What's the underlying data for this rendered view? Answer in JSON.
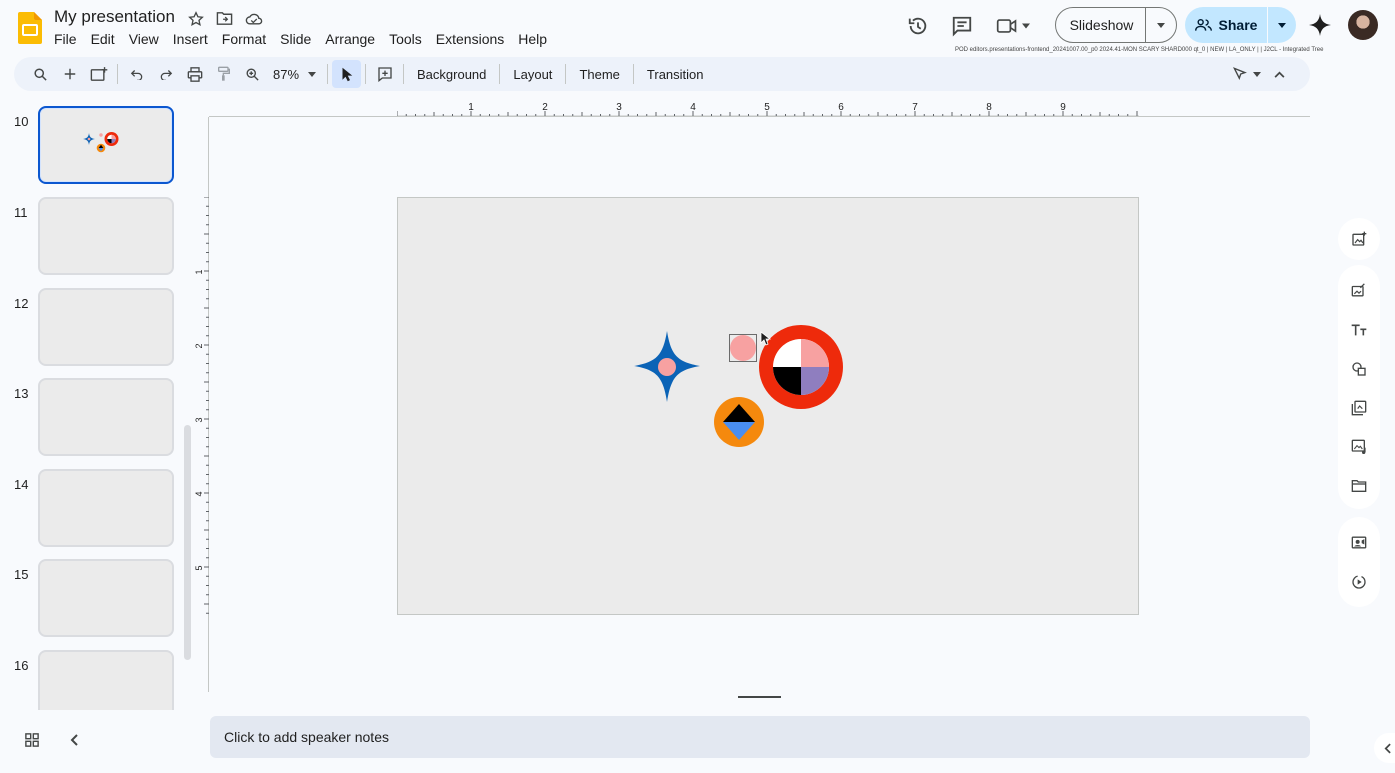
{
  "document": {
    "title": "My presentation",
    "build_info": "POD editors.presentations-frontend_20241007.00_p0 2024.41-MON SCARY SHARD000 qt_0 | NEW | LA_ONLY |  | J2CL - Integrated Tree"
  },
  "menu": [
    "File",
    "Edit",
    "View",
    "Insert",
    "Format",
    "Slide",
    "Arrange",
    "Tools",
    "Extensions",
    "Help"
  ],
  "header": {
    "slideshow_label": "Slideshow",
    "share_label": "Share"
  },
  "toolbar": {
    "zoom": "87%",
    "background_label": "Background",
    "layout_label": "Layout",
    "theme_label": "Theme",
    "transition_label": "Transition"
  },
  "filmstrip": {
    "slides": [
      {
        "number": "10",
        "active": true
      },
      {
        "number": "11",
        "active": false
      },
      {
        "number": "12",
        "active": false
      },
      {
        "number": "13",
        "active": false
      },
      {
        "number": "14",
        "active": false
      },
      {
        "number": "15",
        "active": false
      },
      {
        "number": "16",
        "active": false
      }
    ]
  },
  "rulers": {
    "horizontal": [
      "1",
      "2",
      "3",
      "4",
      "5",
      "6",
      "7",
      "8",
      "9"
    ],
    "vertical": [
      "1",
      "2",
      "3",
      "4",
      "5"
    ]
  },
  "notes": {
    "placeholder": "Click to add speaker notes"
  },
  "colors": {
    "accent": "#0b57d0",
    "share_bg": "#c2e7ff",
    "slide_bg": "#ebebeb",
    "star_blue": "#0b63b6",
    "pink": "#f7a1a1",
    "red_ring": "#ee2a0b",
    "orange": "#f5890d",
    "purple": "#8f7ebf",
    "diamond_blue": "#4a8ef0"
  }
}
